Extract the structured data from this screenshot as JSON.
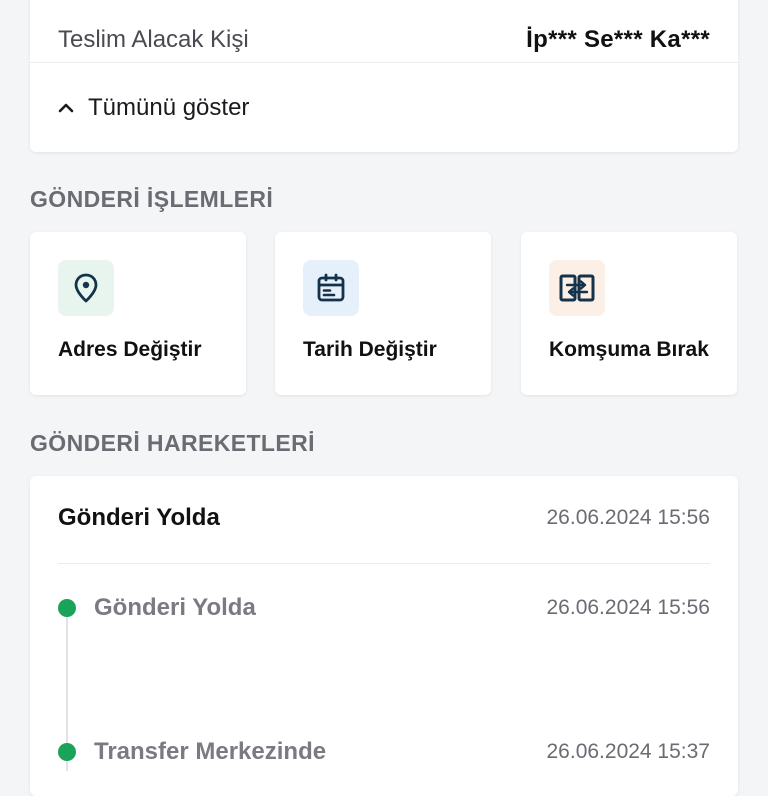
{
  "recipient": {
    "label": "Teslim Alacak Kişi",
    "value": "İp*** Se*** Ka***",
    "show_all": "Tümünü göster"
  },
  "operations": {
    "title": "GÖNDERİ İŞLEMLERİ",
    "items": [
      {
        "label": "Adres Değiştir",
        "icon": "location-pin-icon",
        "bg": "#e8f5ee"
      },
      {
        "label": "Tarih Değiştir",
        "icon": "calendar-icon",
        "bg": "#e6f0fb"
      },
      {
        "label": "Komşuma Bırak",
        "icon": "neighbor-transfer-icon",
        "bg": "#fcefe6"
      }
    ]
  },
  "movements": {
    "title": "GÖNDERİ HAREKETLERİ",
    "current": {
      "status": "Gönderi Yolda",
      "date": "26.06.2024 15:56"
    },
    "history": [
      {
        "status": "Gönderi Yolda",
        "date": "26.06.2024 15:56"
      },
      {
        "status": "Transfer Merkezinde",
        "date": "26.06.2024 15:37"
      }
    ]
  },
  "colors": {
    "icon": "#14324a",
    "timeline_dot": "#19a35b"
  }
}
